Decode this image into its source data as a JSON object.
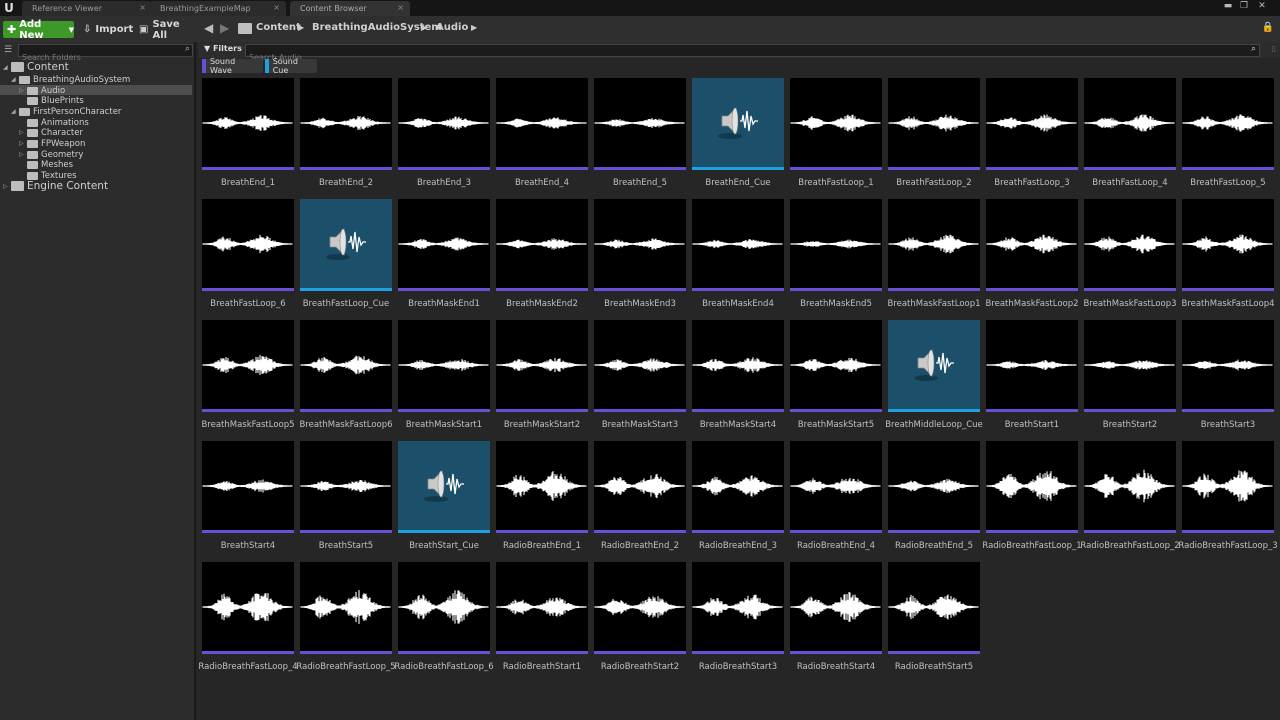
{
  "colors": {
    "sound_wave": "#6a4fd6",
    "sound_cue": "#1fa0e0",
    "add_new": "#3d9a28"
  },
  "window": {
    "logo": "U",
    "tabs": [
      {
        "label": "Reference Viewer"
      },
      {
        "label": "BreathingExampleMap"
      },
      {
        "label": "Content Browser"
      }
    ],
    "close_glyph": "×",
    "controls": [
      "▬",
      "❐",
      "✕"
    ]
  },
  "toolbar": {
    "add_new_label": "Add New",
    "import_label": "Import",
    "save_all_label": "Save All"
  },
  "breadcrumb": [
    "Content",
    "BreathingAudioSystem",
    "Audio"
  ],
  "folders": {
    "search_placeholder": "Search Folders",
    "tree": [
      {
        "label": "Content",
        "depth": 0,
        "big": true,
        "expanded": true
      },
      {
        "label": "BreathingAudioSystem",
        "depth": 1,
        "expanded": true
      },
      {
        "label": "Audio",
        "depth": 2,
        "selected": true,
        "collapsed": true
      },
      {
        "label": "BluePrints",
        "depth": 2
      },
      {
        "label": "FirstPersonCharacter",
        "depth": 1,
        "expanded": true
      },
      {
        "label": "Animations",
        "depth": 2
      },
      {
        "label": "Character",
        "depth": 2,
        "collapsed": true
      },
      {
        "label": "FPWeapon",
        "depth": 2,
        "collapsed": true
      },
      {
        "label": "Geometry",
        "depth": 2,
        "collapsed": true
      },
      {
        "label": "Meshes",
        "depth": 2
      },
      {
        "label": "Textures",
        "depth": 2
      },
      {
        "label": "Engine Content",
        "depth": 0,
        "big": true,
        "collapsed": true
      }
    ]
  },
  "filters": {
    "label": "Filters",
    "search_placeholder": "Search Audio",
    "chips": [
      {
        "label": "Sound Wave",
        "type": "wave"
      },
      {
        "label": "Sound Cue",
        "type": "cue"
      }
    ]
  },
  "assets": [
    {
      "name": "BreathEnd_1",
      "type": "wave",
      "amp": 0.35
    },
    {
      "name": "BreathEnd_2",
      "type": "wave",
      "amp": 0.3
    },
    {
      "name": "BreathEnd_3",
      "type": "wave",
      "amp": 0.25
    },
    {
      "name": "BreathEnd_4",
      "type": "wave",
      "amp": 0.2
    },
    {
      "name": "BreathEnd_5",
      "type": "wave",
      "amp": 0.15
    },
    {
      "name": "BreathEnd_Cue",
      "type": "cue"
    },
    {
      "name": "BreathFastLoop_1",
      "type": "wave",
      "amp": 0.4
    },
    {
      "name": "BreathFastLoop_2",
      "type": "wave",
      "amp": 0.4
    },
    {
      "name": "BreathFastLoop_3",
      "type": "wave",
      "amp": 0.4
    },
    {
      "name": "BreathFastLoop_4",
      "type": "wave",
      "amp": 0.4
    },
    {
      "name": "BreathFastLoop_5",
      "type": "wave",
      "amp": 0.4
    },
    {
      "name": "BreathFastLoop_6",
      "type": "wave",
      "amp": 0.45
    },
    {
      "name": "BreathFastLoop_Cue",
      "type": "cue"
    },
    {
      "name": "BreathMaskEnd1",
      "type": "wave",
      "amp": 0.25
    },
    {
      "name": "BreathMaskEnd2",
      "type": "wave",
      "amp": 0.2
    },
    {
      "name": "BreathMaskEnd3",
      "type": "wave",
      "amp": 0.18
    },
    {
      "name": "BreathMaskEnd4",
      "type": "wave",
      "amp": 0.15
    },
    {
      "name": "BreathMaskEnd5",
      "type": "wave",
      "amp": 0.1
    },
    {
      "name": "BreathMaskFastLoop1",
      "type": "wave",
      "amp": 0.45
    },
    {
      "name": "BreathMaskFastLoop2",
      "type": "wave",
      "amp": 0.45
    },
    {
      "name": "BreathMaskFastLoop3",
      "type": "wave",
      "amp": 0.45
    },
    {
      "name": "BreathMaskFastLoop4",
      "type": "wave",
      "amp": 0.45
    },
    {
      "name": "BreathMaskFastLoop5",
      "type": "wave",
      "amp": 0.5
    },
    {
      "name": "BreathMaskFastLoop6",
      "type": "wave",
      "amp": 0.5
    },
    {
      "name": "BreathMaskStart1",
      "type": "wave",
      "amp": 0.25
    },
    {
      "name": "BreathMaskStart2",
      "type": "wave",
      "amp": 0.3
    },
    {
      "name": "BreathMaskStart3",
      "type": "wave",
      "amp": 0.3
    },
    {
      "name": "BreathMaskStart4",
      "type": "wave",
      "amp": 0.35
    },
    {
      "name": "BreathMaskStart5",
      "type": "wave",
      "amp": 0.35
    },
    {
      "name": "BreathMiddleLoop_Cue",
      "type": "cue"
    },
    {
      "name": "BreathStart1",
      "type": "wave",
      "amp": 0.15
    },
    {
      "name": "BreathStart2",
      "type": "wave",
      "amp": 0.15
    },
    {
      "name": "BreathStart3",
      "type": "wave",
      "amp": 0.2
    },
    {
      "name": "BreathStart4",
      "type": "wave",
      "amp": 0.25
    },
    {
      "name": "BreathStart5",
      "type": "wave",
      "amp": 0.25
    },
    {
      "name": "BreathStart_Cue",
      "type": "cue"
    },
    {
      "name": "RadioBreathEnd_1",
      "type": "wave",
      "amp": 0.9
    },
    {
      "name": "RadioBreathEnd_2",
      "type": "wave",
      "amp": 0.75
    },
    {
      "name": "RadioBreathEnd_3",
      "type": "wave",
      "amp": 0.6
    },
    {
      "name": "RadioBreathEnd_4",
      "type": "wave",
      "amp": 0.5
    },
    {
      "name": "RadioBreathEnd_5",
      "type": "wave",
      "amp": 0.3
    },
    {
      "name": "RadioBreathFastLoop_1",
      "type": "wave",
      "amp": 1.0
    },
    {
      "name": "RadioBreathFastLoop_2",
      "type": "wave",
      "amp": 1.0
    },
    {
      "name": "RadioBreathFastLoop_3",
      "type": "wave",
      "amp": 1.0
    },
    {
      "name": "RadioBreathFastLoop_4",
      "type": "wave",
      "amp": 1.0
    },
    {
      "name": "RadioBreathFastLoop_5",
      "type": "wave",
      "amp": 1.0
    },
    {
      "name": "RadioBreathFastLoop_6",
      "type": "wave",
      "amp": 1.0
    },
    {
      "name": "RadioBreathStart1",
      "type": "wave",
      "amp": 0.55
    },
    {
      "name": "RadioBreathStart2",
      "type": "wave",
      "amp": 0.65
    },
    {
      "name": "RadioBreathStart3",
      "type": "wave",
      "amp": 0.75
    },
    {
      "name": "RadioBreathStart4",
      "type": "wave",
      "amp": 0.85
    },
    {
      "name": "RadioBreathStart5",
      "type": "wave",
      "amp": 0.85
    }
  ]
}
